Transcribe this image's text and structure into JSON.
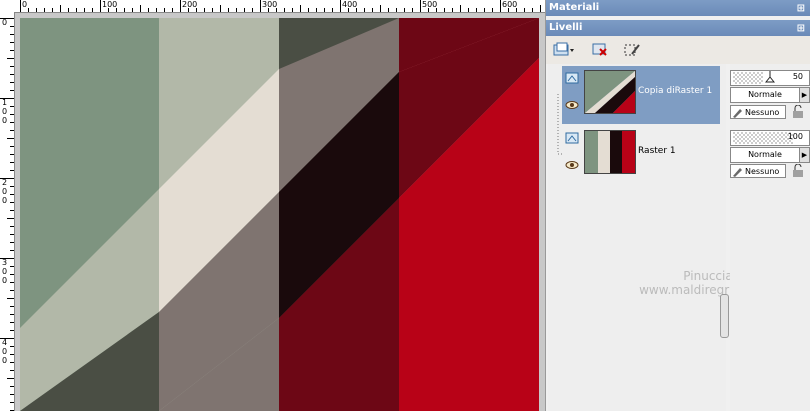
{
  "ruler": {
    "top_labels": [
      "0",
      "100",
      "200",
      "300",
      "400",
      "500",
      "600"
    ],
    "left_labels": [
      "0",
      "1\n0\n0",
      "2\n0\n0",
      "3\n0\n0",
      "4\n0\n0"
    ]
  },
  "panels": {
    "materials_title": "Materiali",
    "layers_title": "Livelli"
  },
  "layers": [
    {
      "name": "Copia diRaster 1",
      "opacity": "50",
      "blend": "Normale",
      "mask": "Nessuno",
      "selected": true
    },
    {
      "name": "Raster 1",
      "opacity": "100",
      "blend": "Normale",
      "mask": "Nessuno",
      "selected": false
    }
  ],
  "watermark": {
    "line1": "Pinuccia",
    "line2": "www.maldiregrafica.eu"
  },
  "colors": {
    "sage": "#7e9480",
    "pale_sage": "#b2b8a8",
    "dark_olive": "#4a4e44",
    "cream": "#e4ddd3",
    "taupe": "#7f7470",
    "near_black": "#1a0a0c",
    "pink": "#cf6b73",
    "maroon": "#6d0715",
    "red": "#b80217",
    "title_bar": "#7d9cc5"
  }
}
